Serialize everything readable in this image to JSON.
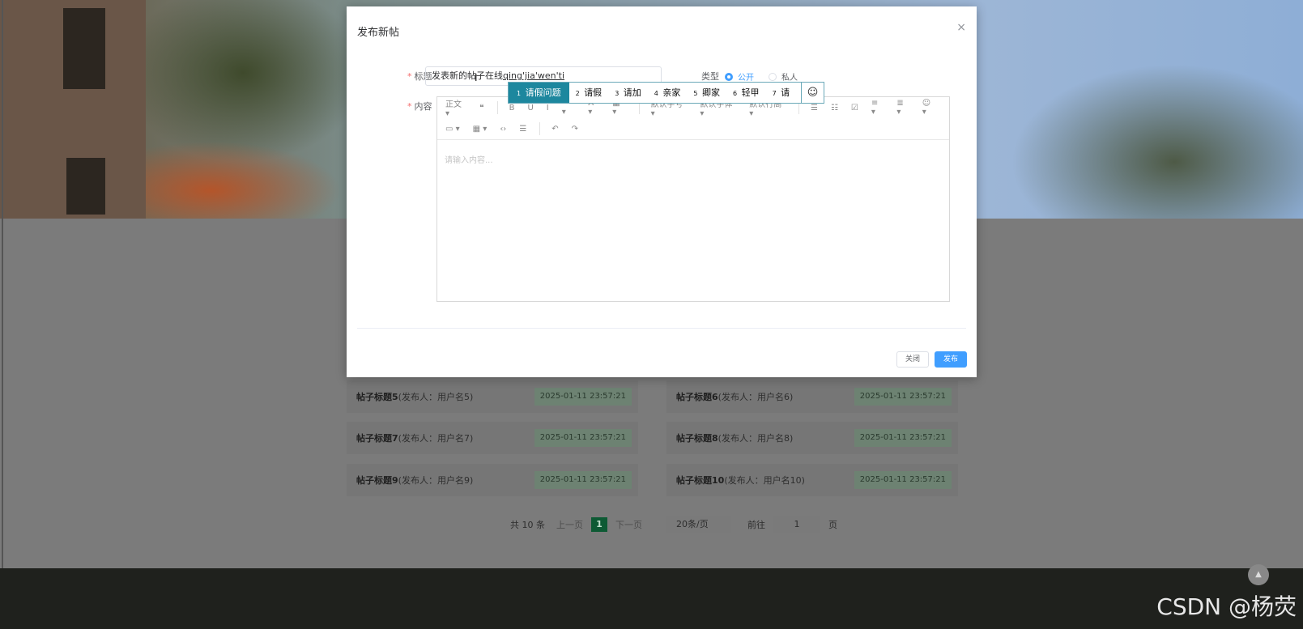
{
  "dialog": {
    "title": "发布新帖",
    "close_glyph": "×",
    "title_label": "标题",
    "title_value_typed": "发表新的",
    "title_value_rest": "帖子在线",
    "title_value_composing": "qing'jia'wen'ti",
    "type_label": "类型",
    "type_options": [
      "公开",
      "私人"
    ],
    "content_label": "内容",
    "editor_placeholder": "请输入内容...",
    "toolbar_row1": [
      "正文 ▾",
      "❝",
      "B",
      "U",
      "I",
      "··· ▾",
      "A ▾",
      "▦ ▾",
      "默认字号 ▾",
      "默认字体 ▾",
      "默认行高 ▾",
      "☰",
      "☷",
      "☑",
      "≡ ▾",
      "≣ ▾",
      "☺ ▾"
    ],
    "toolbar_row2": [
      "▭ ▾",
      "▦ ▾",
      "‹›",
      "☰",
      "↶",
      "↷"
    ],
    "close_button": "关闭",
    "submit_button": "发布"
  },
  "ime": {
    "candidates": [
      {
        "num": "1",
        "text": "请假问题"
      },
      {
        "num": "2",
        "text": "请假"
      },
      {
        "num": "3",
        "text": "请加"
      },
      {
        "num": "4",
        "text": "亲家"
      },
      {
        "num": "5",
        "text": "卿家"
      },
      {
        "num": "6",
        "text": "轻甲"
      },
      {
        "num": "7",
        "text": "请"
      }
    ],
    "emoji": "☺"
  },
  "posts": [
    {
      "title": "帖子标题5",
      "author": "(发布人：用户名5)",
      "date": "2025-01-11 23:57:21"
    },
    {
      "title": "帖子标题6",
      "author": "(发布人：用户名6)",
      "date": "2025-01-11 23:57:21"
    },
    {
      "title": "帖子标题7",
      "author": "(发布人：用户名7)",
      "date": "2025-01-11 23:57:21"
    },
    {
      "title": "帖子标题8",
      "author": "(发布人：用户名8)",
      "date": "2025-01-11 23:57:21"
    },
    {
      "title": "帖子标题9",
      "author": "(发布人：用户名9)",
      "date": "2025-01-11 23:57:21"
    },
    {
      "title": "帖子标题10",
      "author": "(发布人：用户名10)",
      "date": "2025-01-11 23:57:21"
    }
  ],
  "pagination": {
    "total": "共 10 条",
    "prev": "上一页",
    "current": "1",
    "next": "下一页",
    "page_size": "20条/页",
    "goto_label": "前往",
    "goto_value": "1",
    "page_unit": "页"
  },
  "back_to_top": "▲",
  "watermark": "CSDN @杨荧",
  "colors": {
    "accent": "#409eff",
    "ime_selected": "#1d879e",
    "page_current": "#0d5a34"
  }
}
